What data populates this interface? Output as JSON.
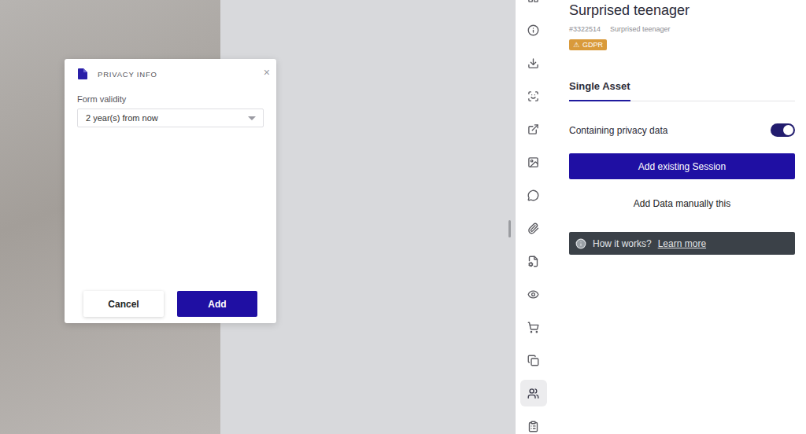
{
  "modal": {
    "title": "PRIVACY INFO",
    "close": "×",
    "field_label": "Form validity",
    "field_value": "2 year(s) from now",
    "buttons": [
      {
        "label": "Cancel",
        "primary": false
      },
      {
        "label": "Add",
        "primary": true
      }
    ]
  },
  "toolbar": {
    "items": [
      {
        "selected": false
      },
      {
        "selected": false
      },
      {
        "selected": false
      },
      {
        "selected": false
      },
      {
        "selected": false
      },
      {
        "selected": false
      },
      {
        "selected": false
      },
      {
        "selected": false
      },
      {
        "selected": false
      },
      {
        "selected": false
      },
      {
        "selected": false
      },
      {
        "selected": false
      },
      {
        "selected": true
      },
      {
        "selected": false
      }
    ]
  },
  "asset": {
    "title": "Surprised teenager",
    "id": "#3322514",
    "subtitle": "Surprised teenager",
    "badge": {
      "icon": "⚠",
      "label": "GDPR"
    }
  },
  "tabs": [
    {
      "label": "Single Asset",
      "selected": true
    }
  ],
  "privacy_toggle": {
    "label": "Containing privacy data",
    "on": true
  },
  "primary_action": "Add existing Session",
  "secondary_action": "Add Data manually this",
  "info": {
    "text": "How it works?",
    "link": "Learn more"
  }
}
